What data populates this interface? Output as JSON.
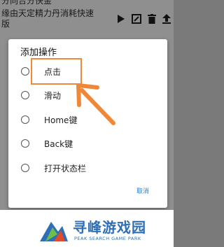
{
  "background": {
    "row1_text": "分向合分快金",
    "row2_text": "缘由天定精力丹消耗快速版"
  },
  "dialog": {
    "title": "添加操作",
    "options": [
      "点击",
      "滑动",
      "Home键",
      "Back键",
      "打开状态栏"
    ],
    "cancel_label": "取消"
  },
  "watermark": {
    "title": "寻峰游戏园",
    "subtitle": "PEAK SEARCH GAME PARK"
  },
  "colors": {
    "accent": "#2d7fd2",
    "annotation": "#f0883a"
  }
}
